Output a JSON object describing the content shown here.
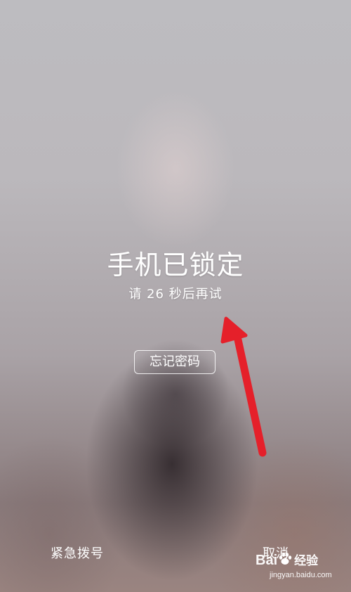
{
  "lock_screen": {
    "title": "手机已锁定",
    "subtitle": "请 26 秒后再试",
    "forgot_password_label": "忘记密码",
    "emergency_call_label": "紧急拨号",
    "cancel_label": "取消"
  },
  "annotation": {
    "arrow_color": "#e5202a"
  },
  "watermark": {
    "logo_prefix": "Bai",
    "logo_icon": "paw-icon",
    "logo_suffix": "经验",
    "url": "jingyan.baidu.com"
  }
}
